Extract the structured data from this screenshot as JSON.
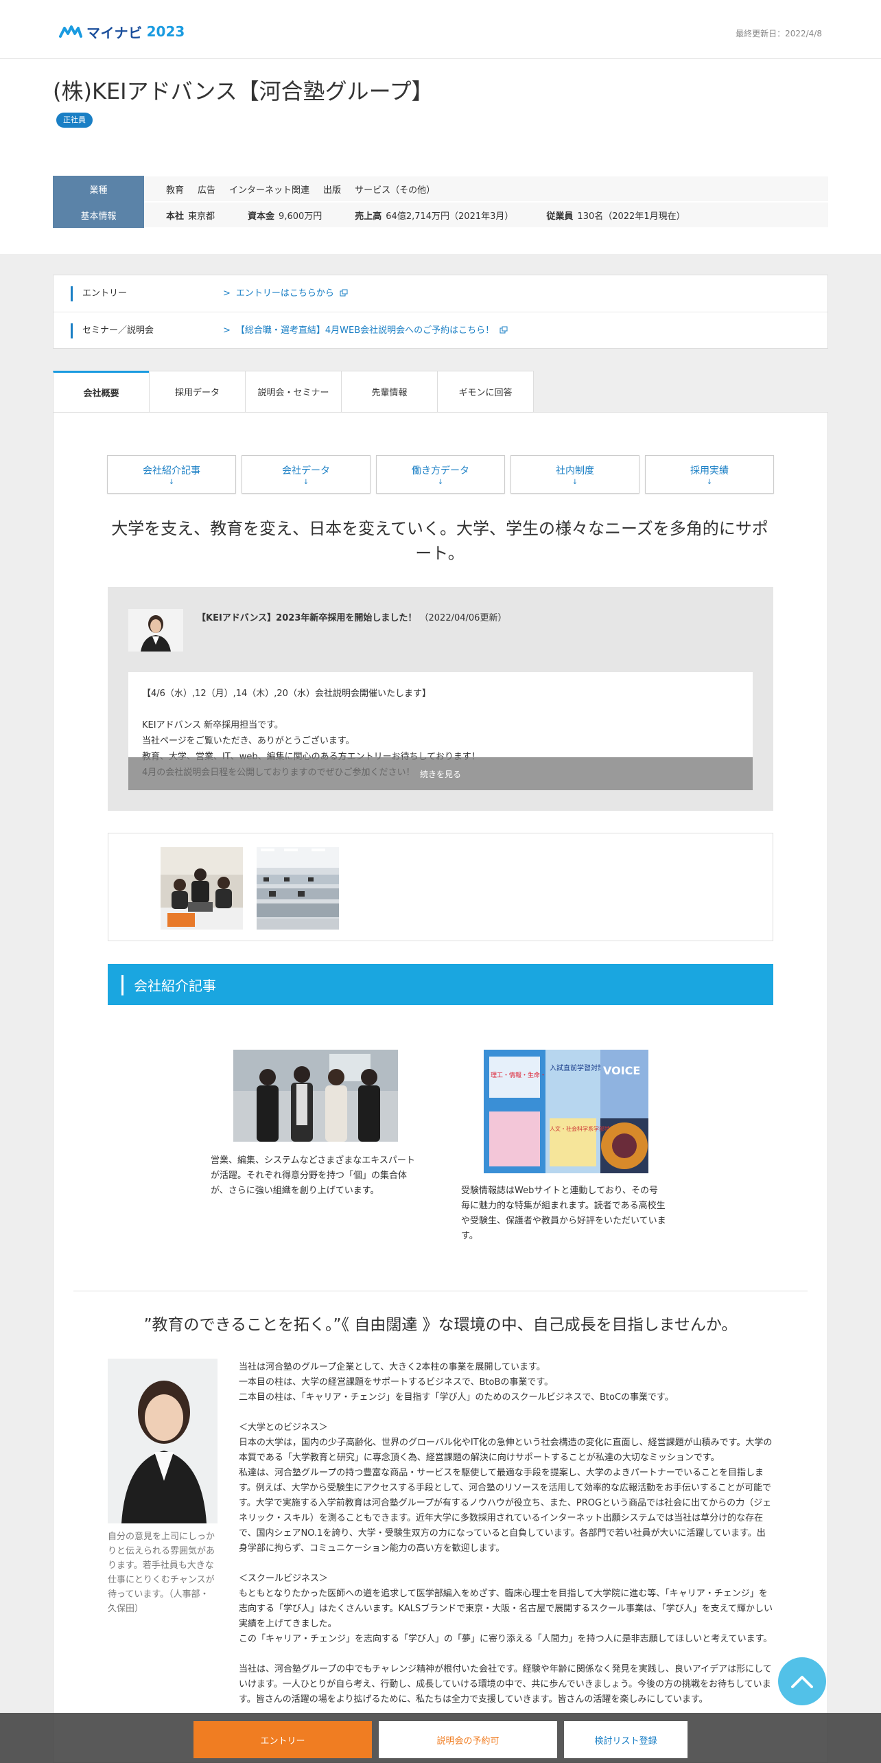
{
  "header": {
    "logo_text": "マイナビ",
    "logo_year": "2023",
    "updated": "最終更新日：2022/4/8"
  },
  "company": {
    "name": "(株)KEIアドバンス【河合塾グループ】",
    "badge": "正社員"
  },
  "info": {
    "industry_label": "業種",
    "industries": [
      "教育",
      "広告",
      "インターネット関連",
      "出版",
      "サービス（その他）"
    ],
    "basic_label": "基本情報",
    "hq_label": "本社",
    "hq_value": "東京都",
    "capital_label": "資本金",
    "capital_value": "9,600万円",
    "sales_label": "売上高",
    "sales_value": "64億2,714万円（2021年3月）",
    "employees_label": "従業員",
    "employees_value": "130名（2022年1月現在）"
  },
  "entry": {
    "entry_label": "エントリー",
    "entry_link": "エントリーはこちらから",
    "seminar_label": "セミナー／説明会",
    "seminar_link": "【総合職・選考直結】4月WEB会社説明会へのご予約はこちら！"
  },
  "tabs": [
    "会社概要",
    "採用データ",
    "説明会・セミナー",
    "先輩情報",
    "ギモンに回答"
  ],
  "anchors": [
    "会社紹介記事",
    "会社データ",
    "働き方データ",
    "社内制度",
    "採用実績"
  ],
  "anchor_arrow": "↓",
  "catch_copy": "大学を支え、教育を変え、日本を変えていく。大学、学生の様々なニーズを多角的にサポート。",
  "news": {
    "title": "【KEIアドバンス】2023年新卒採用を開始しました！",
    "date": "（2022/04/06更新）",
    "body": "【4/6（水）,12（月）,14（木）,20（水）会社説明会開催いたします】\n\nKEIアドバンス 新卒採用担当です。\n当社ページをご覧いただき、ありがとうございます。\n教育、大学、営業、IT、web、編集に関心のある方エントリーお待ちしております！\n4月の会社説明会日程を公開しておりますのでぜひご参加ください！",
    "more": "続きを見る"
  },
  "section_title": "会社紹介記事",
  "articles": [
    {
      "text": "営業、編集、システムなどさまざまなエキスパートが活躍。それぞれ得意分野を持つ「個」の集合体が、さらに強い組織を創り上げています。"
    },
    {
      "text": "受験情報誌はWebサイトと連動しており、その号毎に魅力的な特集が組まれます。読者である高校生や受験生、保護者や教員から好評をいただいています。"
    }
  ],
  "magazine_text": {
    "voice": "VOICE",
    "cover1": "入試直前学習対策",
    "cover2": "人文・社会科学系学部特集号",
    "cover3": "理工・情報・生命・農学系学部特集号"
  },
  "sub_catch": "”教育のできることを拓く。”《 自由闊達 》な環境の中、自己成長を目指しませんか。",
  "person_caption": "自分の意見を上司にしっかりと伝えられる雰囲気があります。若手社員も大きな仕事にとりくむチャンスが待っています。（人事部・久保田）",
  "body_text": "当社は河合塾のグループ企業として、大きく2本柱の事業を展開しています。\n一本目の柱は、大学の経営課題をサポートするビジネスで、BtoBの事業です。\n二本目の柱は、「キャリア・チェンジ」を目指す「学び人」のためのスクールビジネスで、BtoCの事業です。\n\n＜大学とのビジネス＞\n日本の大学は，国内の少子高齢化、世界のグローバル化やIT化の急伸という社会構造の変化に直面し、経営課題が山積みです。大学の本質である「大学教育と研究」に専念頂く為、経営課題の解決に向けサポートすることが私達の大切なミッションです。\n私達は、河合塾グループの持つ豊富な商品・サービスを駆使して最適な手段を提案し、大学のよきパートナーでいることを目指します。例えば、大学から受験生にアクセスする手段として、河合塾のリソースを活用して効率的な広報活動をお手伝いすることが可能です。大学で実施する入学前教育は河合塾グループが有するノウハウが役立ち、また、PROGという商品では社会に出てからの力（ジェネリック・スキル）を測ることもできます。近年大学に多数採用されているインターネット出願システムでは当社は草分け的な存在で、国内シェアNO.1を誇り、大学・受験生双方の力になっていると自負しています。各部門で若い社員が大いに活躍しています。出身学部に拘らず、コミュニケーション能力の高い方を歓迎します。\n\n＜スクールビジネス＞\nもともとなりたかった医師への道を追求して医学部編入をめざす、臨床心理士を目指して大学院に進む等、「キャリア・チェンジ」を志向する「学び人」はたくさんいます。KALSブランドで東京・大阪・名古屋で展開するスクール事業は、「学び人」を支えて輝かしい実績を上げてきました。\nこの「キャリア・チェンジ」を志向する「学び人」の「夢」に寄り添える「人間力」を持つ人に是非志願してほしいと考えています。\n\n当社は、河合塾グループの中でもチャレンジ精神が根付いた会社です。経験や年齢に関係なく発見を実践し、良いアイデアは形にしていけます。一人ひとりが自ら考え、行動し、成長していける環境の中で、共に歩んでいきましょう。今後の方の挑戦をお待ちしています。皆さんの活躍の場をより拡げるために、私たちは全力で支援していきます。皆さんの活躍を楽しみにしています。",
  "footer": {
    "entry": "エントリー",
    "seminar": "説明会の予約可",
    "list": "検討リスト登録"
  },
  "colors": {
    "brand_blue": "#1a7fc5",
    "section_blue": "#1aa6e0",
    "label_blue": "#5b83a8",
    "orange": "#f07d22"
  }
}
